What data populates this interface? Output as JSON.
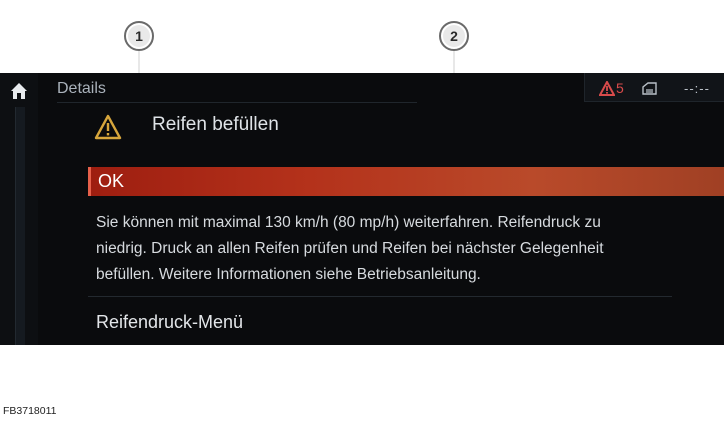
{
  "callouts": {
    "one": "1",
    "two": "2"
  },
  "screen": {
    "title": "Details",
    "status": {
      "warning_count": "5",
      "clock": "--:--"
    },
    "heading": "Reifen befüllen",
    "ok_label": "OK",
    "message_lines": [
      "Sie können mit maximal 130 km/h (80 mp/h) weiterfahren. Reifendruck zu",
      "niedrig. Druck an allen Reifen prüfen und Reifen bei nächster Gelegenheit",
      "befüllen. Weitere Informationen siehe Betriebsanleitung."
    ],
    "menu_item": "Reifendruck-Menü"
  },
  "figure_id": "FB3718011",
  "colors": {
    "screen_bg": "#0a0b0d",
    "ok_bar": "#b4321b",
    "warning_red": "#d94b4b",
    "warning_amber": "#d7a63c"
  },
  "icons": {
    "home": "home-icon",
    "warning": "warning-triangle-icon",
    "status_warning": "warning-triangle-icon",
    "vehicle": "vehicle-status-icon"
  }
}
